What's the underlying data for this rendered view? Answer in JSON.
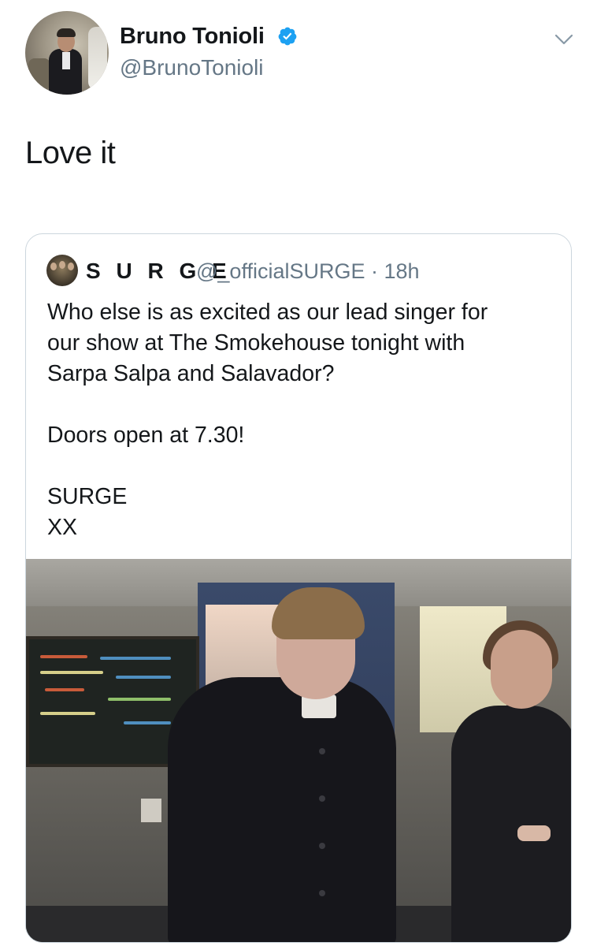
{
  "tweet": {
    "display_name": "Bruno Tonioli",
    "handle": "@BrunoTonioli",
    "text": "Love it",
    "verified": true
  },
  "quoted": {
    "display_name": "S U R G E",
    "handle_time": "@_officialSURGE · 18h",
    "body_lines": [
      "Who else is as excited as our lead singer for",
      "our show at The Smokehouse tonight with",
      "Sarpa Salpa and Salavador?",
      "",
      "Doors open at 7.30!",
      "",
      "SURGE",
      "XX"
    ]
  },
  "icons": {
    "verified": "verified-badge-icon",
    "menu": "chevron-down-icon"
  },
  "colors": {
    "accent": "#1da1f2",
    "secondary_text": "#657786",
    "border": "#ccd6dd"
  }
}
